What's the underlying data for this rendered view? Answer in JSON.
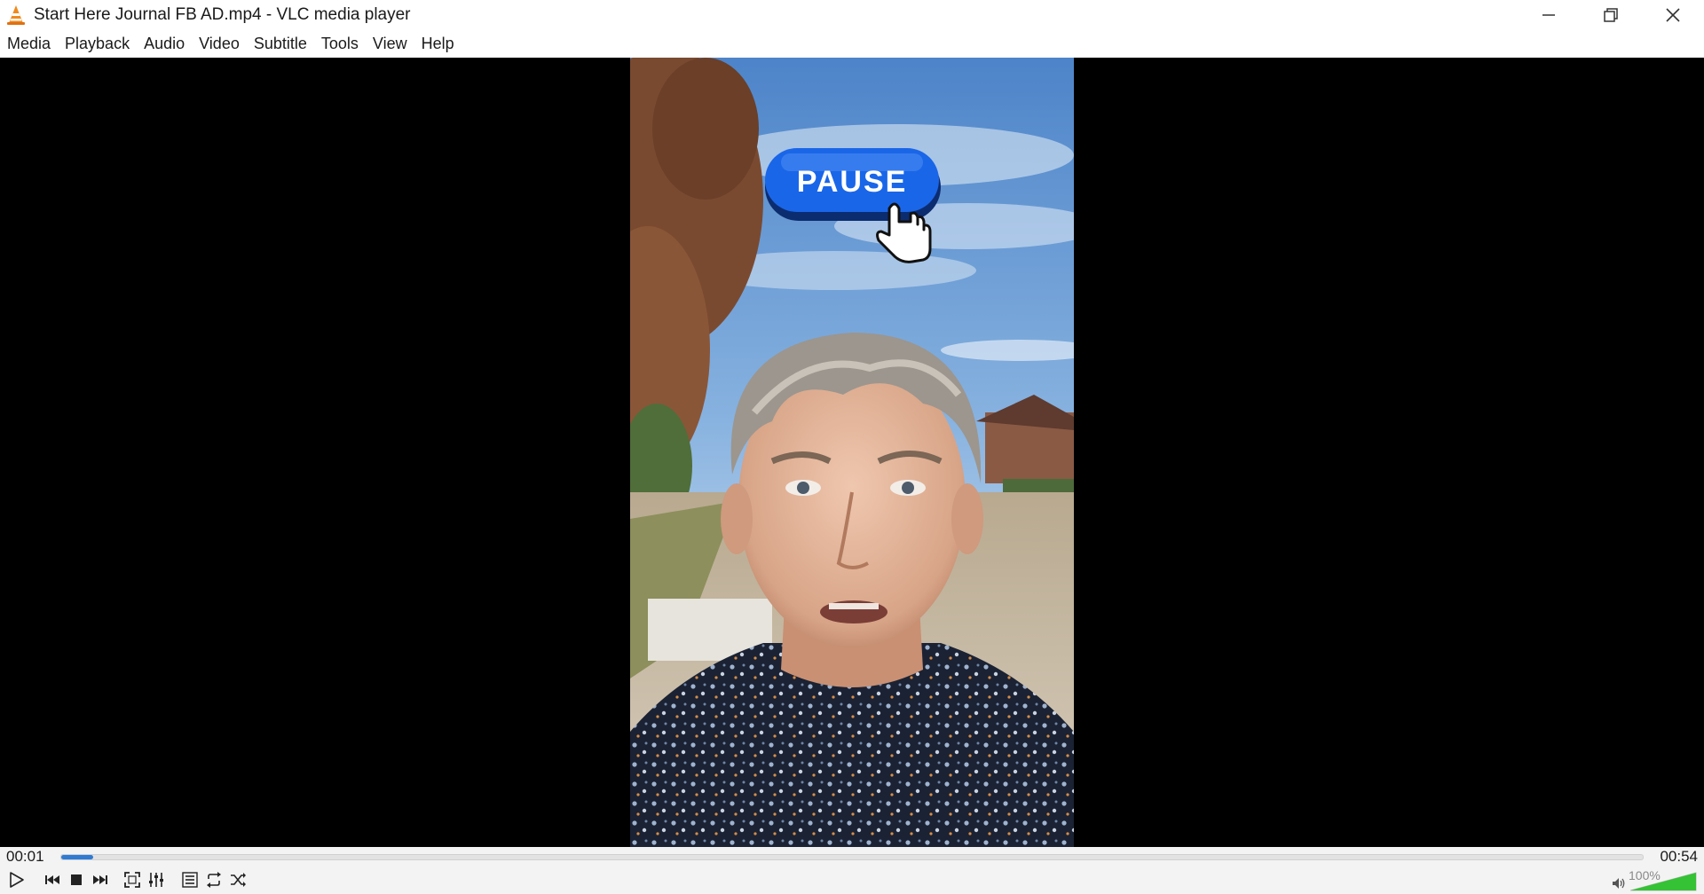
{
  "window": {
    "title": "Start Here Journal FB AD.mp4 - VLC media player"
  },
  "menu": {
    "items": [
      "Media",
      "Playback",
      "Audio",
      "Video",
      "Subtitle",
      "Tools",
      "View",
      "Help"
    ]
  },
  "video": {
    "overlay_text": "PAUSE"
  },
  "seek": {
    "elapsed": "00:01",
    "total": "00:54",
    "progress": 0.02
  },
  "volume": {
    "label": "100%",
    "level": 1.0
  },
  "colors": {
    "accent": "#2f7bd4",
    "vlc_orange": "#f08a1c",
    "pause_button": "#1a66e8"
  },
  "icons": {
    "app": "vlc-cone-icon",
    "minimize": "minimize-icon",
    "maximize": "restore-icon",
    "close": "close-icon",
    "play": "play-icon",
    "previous": "previous-icon",
    "stop": "stop-icon",
    "next": "next-icon",
    "fullscreen": "fullscreen-icon",
    "extended": "extended-settings-icon",
    "playlist": "playlist-icon",
    "loop": "loop-icon",
    "random": "random-icon",
    "volume": "speaker-icon"
  }
}
